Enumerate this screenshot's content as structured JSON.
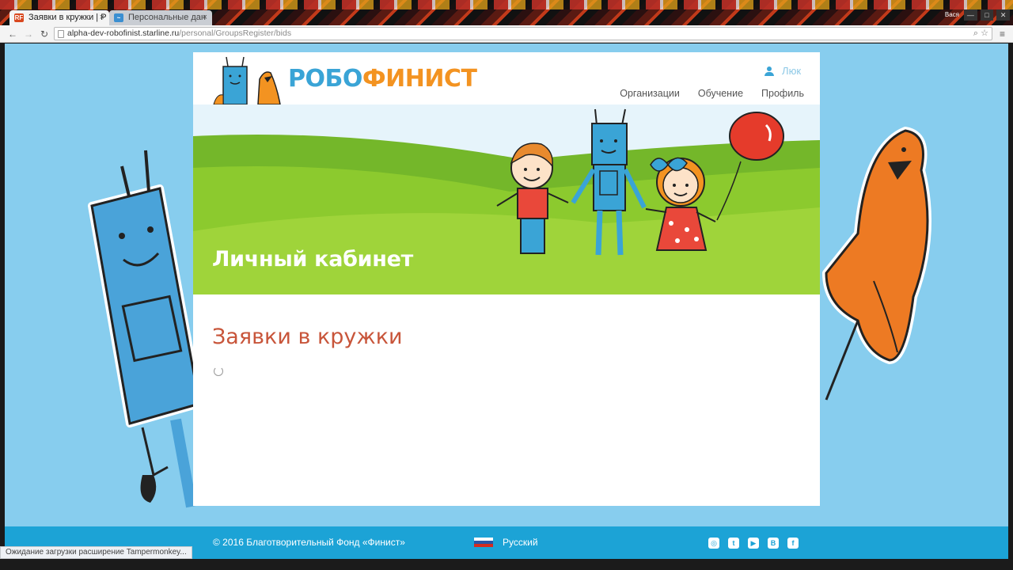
{
  "browser": {
    "tabs": [
      {
        "label": "Заявки в кружки | Р",
        "favicon": "RF",
        "active": true
      },
      {
        "label": "Персональные дан",
        "favicon": "~",
        "active": false
      }
    ],
    "tab_close": "×",
    "user": "Вася",
    "window_controls": [
      "—",
      "□",
      "✕"
    ],
    "nav": {
      "back": "←",
      "forward": "→",
      "reload": "↻"
    },
    "url_host": "alpha-dev-robofinist.starline.ru",
    "url_path": "/personal/GroupsRegister/bids",
    "url_icons": "⌕ ☆",
    "menu_icon": "≡",
    "status": "Ожидание загрузки расширение Tampermonkey..."
  },
  "site": {
    "logo_part1": "РОБО",
    "logo_part2": "ФИНИСТ",
    "user_name": "Люк",
    "nav": [
      "Организации",
      "Обучение",
      "Профиль"
    ],
    "banner_title": "Личный кабинет",
    "page_title": "Заявки в кружки",
    "footer_copyright": "© 2016 Благотворительный Фонд «Финист»",
    "language": "Русский",
    "social": [
      {
        "icon": "instagram-icon",
        "glyph": "◎"
      },
      {
        "icon": "twitter-icon",
        "glyph": "t"
      },
      {
        "icon": "youtube-icon",
        "glyph": "▶"
      },
      {
        "icon": "vk-icon",
        "glyph": "B"
      },
      {
        "icon": "facebook-icon",
        "glyph": "f"
      }
    ]
  },
  "colors": {
    "page_bg": "#87cdee",
    "brand_blue": "#3aa4d6",
    "brand_orange": "#f39321",
    "footer_bg": "#1ca3d6",
    "heading_red": "#c8553a",
    "banner_green": "#8cca2e"
  }
}
